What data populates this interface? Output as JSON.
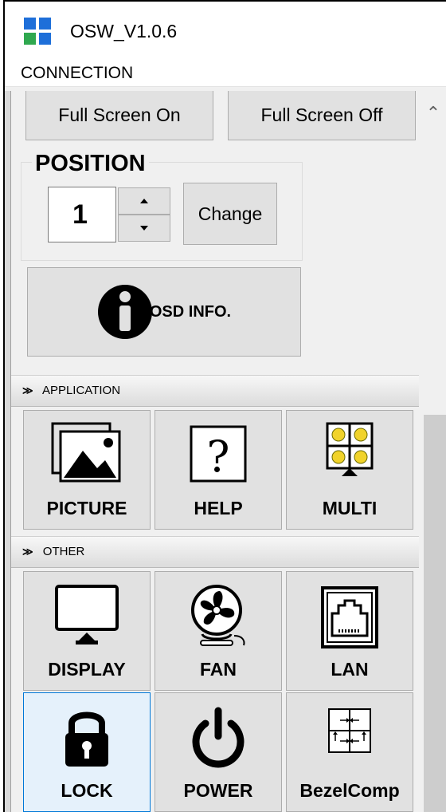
{
  "window": {
    "title": "OSW_V1.0.6"
  },
  "menu": {
    "connection": "CONNECTION"
  },
  "fullscreen": {
    "on_label": "Full Screen On",
    "off_label": "Full Screen Off"
  },
  "position": {
    "label": "POSITION",
    "value": "1",
    "change_label": "Change"
  },
  "osd_info": {
    "label": "OSD INFO."
  },
  "application_section": {
    "header": "APPLICATION",
    "tiles": [
      {
        "label": "PICTURE",
        "icon": "picture-icon"
      },
      {
        "label": "HELP",
        "icon": "help-icon"
      },
      {
        "label": "MULTI",
        "icon": "multi-screen-icon"
      }
    ]
  },
  "other_section": {
    "header": "OTHER",
    "tiles": [
      {
        "label": "DISPLAY",
        "icon": "monitor-icon"
      },
      {
        "label": "FAN",
        "icon": "fan-icon"
      },
      {
        "label": "LAN",
        "icon": "ethernet-port-icon"
      },
      {
        "label": "LOCK",
        "icon": "padlock-icon",
        "selected": true
      },
      {
        "label": "POWER",
        "icon": "power-icon"
      },
      {
        "label": "BezelComp",
        "icon": "bezel-compensation-icon"
      }
    ]
  },
  "colors": {
    "logo_blue": "#1e6fd9",
    "logo_green": "#2fa84f",
    "selected_tile_bg": "#e5f1fb",
    "selected_tile_border": "#0078d7"
  }
}
